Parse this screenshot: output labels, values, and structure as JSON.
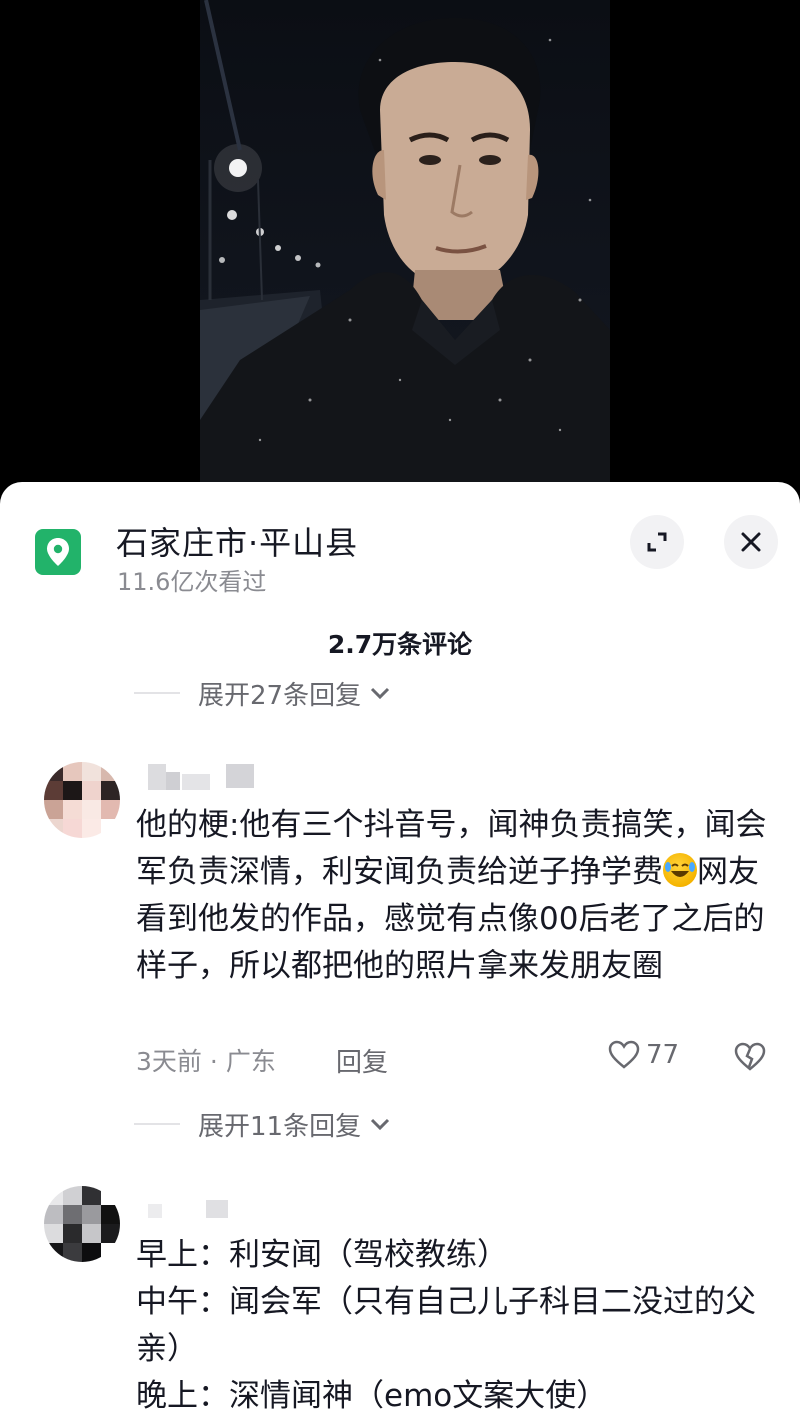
{
  "header": {
    "location_title": "石家庄市·平山县",
    "views": "11.6亿次看过",
    "comment_count": "2.7万条评论"
  },
  "icons": {
    "location": "location-pin-icon",
    "expand": "expand-icon",
    "close": "close-icon",
    "chevron": "chevron-down-icon",
    "like": "heart-icon",
    "dislike": "broken-heart-icon",
    "emoji": "rofl-emoji"
  },
  "colors": {
    "accent": "#22b36a",
    "text": "#161823",
    "muted": "#8a8b91"
  },
  "expand_replies_top": "展开27条回复",
  "comments": [
    {
      "text_before_emoji": "他的梗:他有三个抖音号，闻神负责搞笑，闻会军负责深情，利安闻负责给逆子挣学费",
      "text_after_emoji": "网友看到他发的作品，感觉有点像00后老了之后的样子，所以都把他的照片拿来发朋友圈",
      "time": "3天前",
      "region": "广东",
      "reply_label": "回复",
      "likes": "77",
      "expand_replies": "展开11条回复"
    },
    {
      "lines": [
        "早上：利安闻（驾校教练）",
        "中午：闻会军（只有自己儿子科目二没过的父亲）",
        "晚上：深情闻神（emo文案大使）"
      ]
    }
  ]
}
